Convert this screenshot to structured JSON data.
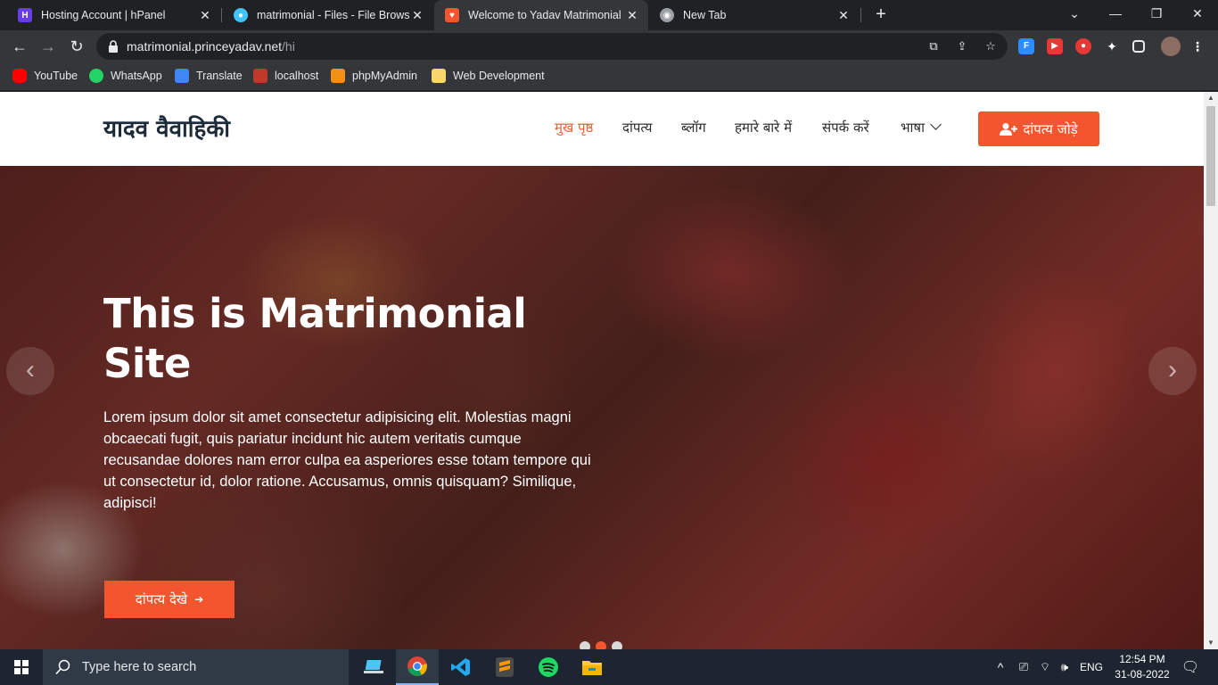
{
  "browser": {
    "tabs": [
      {
        "title": "Hosting Account | hPanel",
        "icon": "hostinger-icon",
        "color": "#673de6",
        "active": false
      },
      {
        "title": "matrimonial - Files - File Browser",
        "icon": "filebrowser-icon",
        "color": "#40c4ff",
        "active": false
      },
      {
        "title": "Welcome to Yadav Matrimonial S",
        "icon": "site-favicon",
        "color": "#f3552f",
        "active": true
      },
      {
        "title": "New Tab",
        "icon": "chrome-icon",
        "color": "#9aa0a6",
        "active": false
      }
    ],
    "new_tab_label": "+",
    "url_host": "matrimonial.princeyadav.net",
    "url_path": "/hi",
    "bookmarks": [
      {
        "label": "YouTube",
        "icon": "youtube-icon",
        "color": "#ff0000"
      },
      {
        "label": "WhatsApp",
        "icon": "whatsapp-icon",
        "color": "#25d366"
      },
      {
        "label": "Translate",
        "icon": "translate-icon",
        "color": "#4285f4"
      },
      {
        "label": "localhost",
        "icon": "localhost-icon",
        "color": "#c0392b"
      },
      {
        "label": "phpMyAdmin",
        "icon": "phpmyadmin-icon",
        "color": "#f29111"
      },
      {
        "label": "Web Development",
        "icon": "folder-icon",
        "color": "#f9d56e"
      }
    ]
  },
  "site": {
    "logo": "यादव वैवाहिकी",
    "nav": [
      {
        "label": "मुख पृष्ठ",
        "active": true
      },
      {
        "label": "दांपत्य",
        "active": false
      },
      {
        "label": "ब्लॉग",
        "active": false
      },
      {
        "label": "हमारे बारे में",
        "active": false
      },
      {
        "label": "संपर्क करें",
        "active": false
      },
      {
        "label": "भाषा",
        "active": false
      }
    ],
    "add_button": "दांपत्य जोड़े",
    "accent_color": "#f3552f",
    "hero": {
      "title": "This is Matrimonial Site",
      "text": "Lorem ipsum dolor sit amet consectetur adipisicing elit. Molestias magni obcaecati fugit, quis pariatur incidunt hic autem veritatis cumque recusandae dolores nam error culpa ea asperiores esse totam tempore qui ut consectetur id, dolor ratione. Accusamus, omnis quisquam? Similique, adipisci!",
      "cta": "दांपत्य देखे",
      "slides": 3,
      "current_slide": 2
    }
  },
  "taskbar": {
    "search_placeholder": "Type here to search",
    "language": "ENG",
    "time": "12:54 PM",
    "date": "31-08-2022"
  }
}
